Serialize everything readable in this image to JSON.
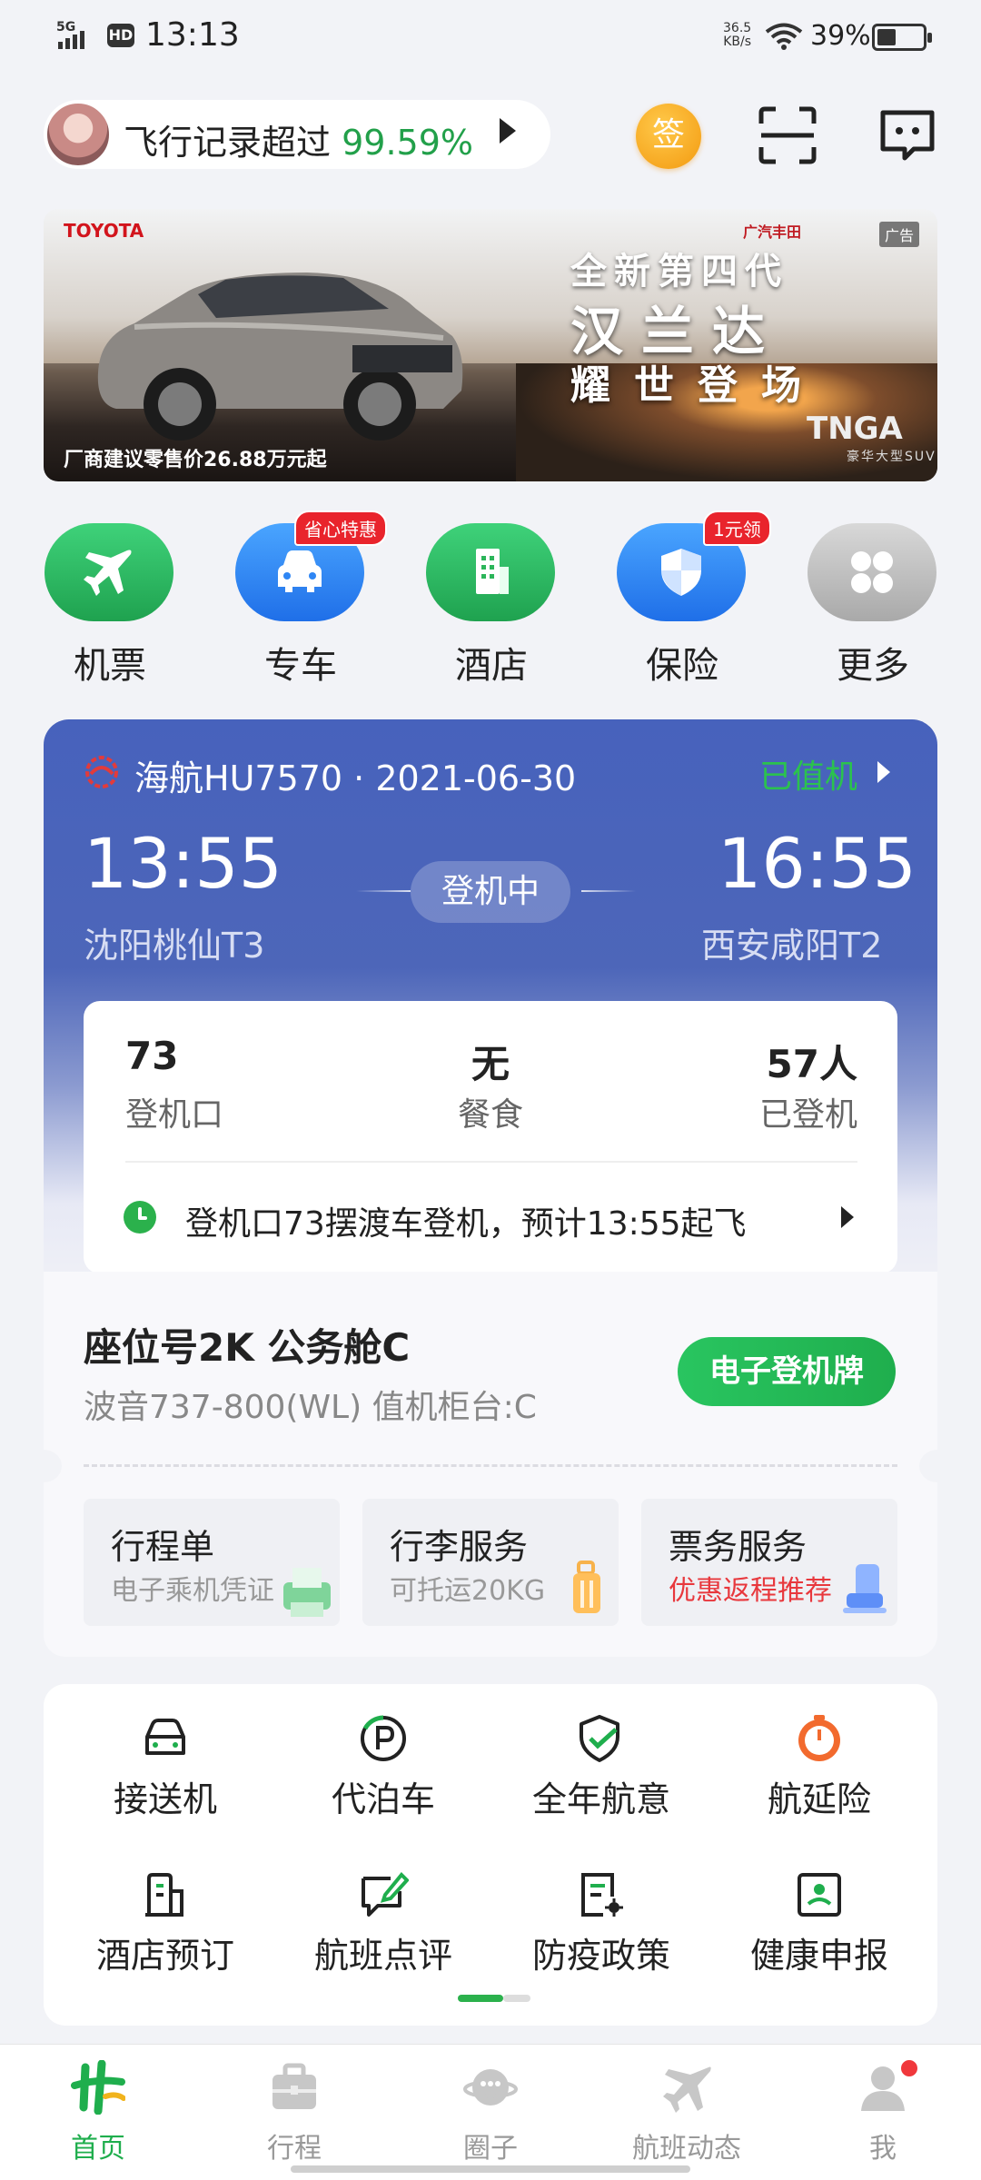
{
  "status_bar": {
    "network": "5G",
    "hd": "HD",
    "time": "13:13",
    "speed_value": "36.5",
    "speed_unit": "KB/s",
    "battery": "39%"
  },
  "top_bar": {
    "record_text": "飞行记录超过",
    "record_percent": "99.59%",
    "sign_label": "签"
  },
  "banner": {
    "brand_left": "TOYOTA",
    "brand_right": "广汽丰田",
    "ad_tag": "广告",
    "line1": "全新第四代",
    "line2": "汉兰达",
    "line3": "耀世登场",
    "price": "厂商建议零售价26.88万元起",
    "tnga": "TNGA",
    "suv": "豪华大型SUV"
  },
  "main_icons": [
    {
      "label": "机票",
      "badge": "",
      "color_from": "#3fd27a",
      "color_to": "#1fa24f"
    },
    {
      "label": "专车",
      "badge": "省心特惠",
      "color_from": "#4aa5ff",
      "color_to": "#1f6fe8"
    },
    {
      "label": "酒店",
      "badge": "",
      "color_from": "#3fd27a",
      "color_to": "#1fa24f"
    },
    {
      "label": "保险",
      "badge": "1元领",
      "color_from": "#4aa5ff",
      "color_to": "#1f6fe8"
    },
    {
      "label": "更多",
      "badge": "",
      "color_from": "#d8d8d8",
      "color_to": "#a9a9a9"
    }
  ],
  "flight": {
    "title": "海航HU7570 · 2021-06-30",
    "status": "已值机",
    "dep_time": "13:55",
    "arr_time": "16:55",
    "dep_airport": "沈阳桃仙T3",
    "arr_airport": "西安咸阳T2",
    "boarding_status": "登机中",
    "gate_value": "73",
    "gate_label": "登机口",
    "meal_value": "无",
    "meal_label": "餐食",
    "boarded_value": "57人",
    "boarded_label": "已登机",
    "notice": "登机口73摆渡车登机，预计13:55起飞"
  },
  "seat": {
    "title": "座位号2K 公务舱C",
    "subtitle": "波音737-800(WL) 值机柜台:C",
    "boarding_pass": "电子登机牌"
  },
  "services": [
    {
      "title": "行程单",
      "sub": "电子乘机凭证"
    },
    {
      "title": "行李服务",
      "sub": "可托运20KG"
    },
    {
      "title": "票务服务",
      "sub": "优惠返程推荐"
    }
  ],
  "quick": [
    {
      "label": "接送机"
    },
    {
      "label": "代泊车"
    },
    {
      "label": "全年航意"
    },
    {
      "label": "航延险"
    },
    {
      "label": "酒店预订"
    },
    {
      "label": "航班点评"
    },
    {
      "label": "防疫政策"
    },
    {
      "label": "健康申报"
    }
  ],
  "nav": [
    {
      "label": "首页"
    },
    {
      "label": "行程"
    },
    {
      "label": "圈子"
    },
    {
      "label": "航班动态"
    },
    {
      "label": "我"
    }
  ],
  "colors": {
    "green": "#22a04a",
    "flight_blue": "#4762bc",
    "badge_red": "#e9242c"
  }
}
